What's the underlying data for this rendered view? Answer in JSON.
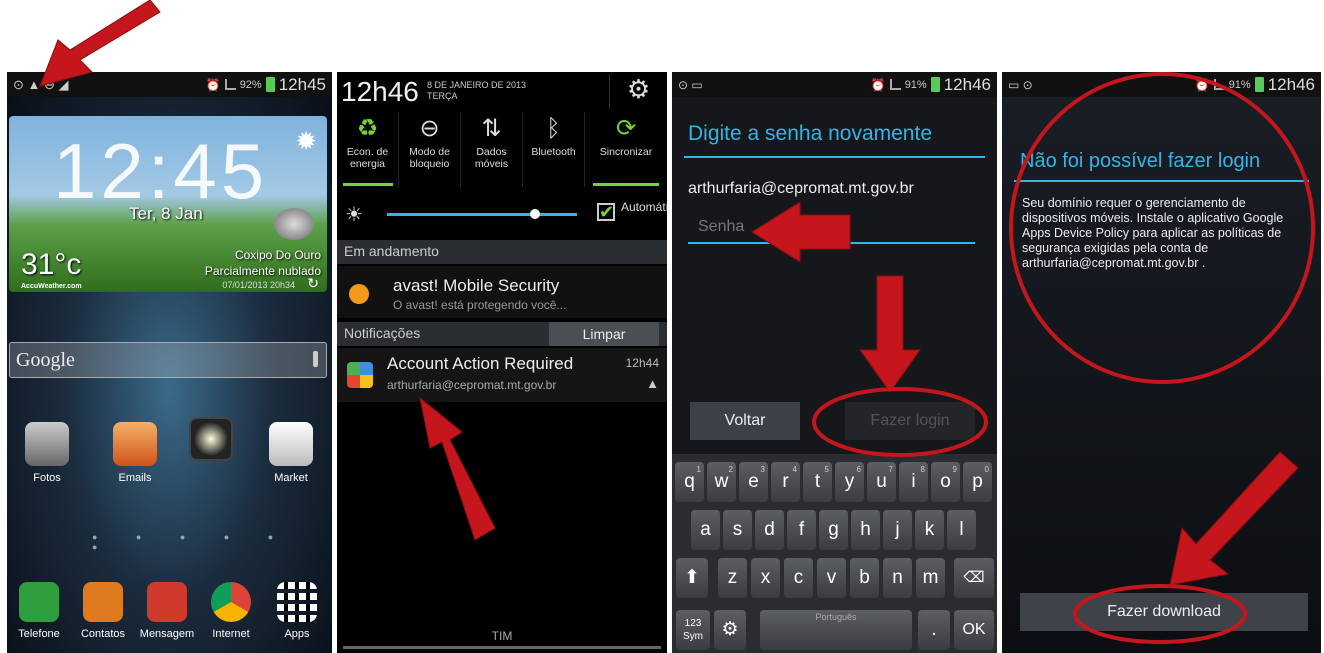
{
  "panel1": {
    "status_time": "12h45",
    "battery": "92%",
    "clock": "12:45",
    "date": "Ter, 8 Jan",
    "temp": "31°c",
    "location": "Coxipo Do Ouro",
    "weather": "Parcialmente nublado",
    "updated": "07/01/2013 20h34",
    "accuweather": "AccuWeather.com",
    "search": "Google",
    "row1": [
      "Fotos",
      "Emails",
      "",
      "Market"
    ],
    "dock": [
      "Telefone",
      "Contatos",
      "Mensagem",
      "Internet",
      "Apps"
    ]
  },
  "panel2": {
    "time": "12h46",
    "date": "8 DE JANEIRO DE 2013",
    "weekday": "TERÇA",
    "toggles": [
      "Econ. de energia",
      "Modo de bloqueio",
      "Dados móveis",
      "Bluetooth",
      "Sincronizar"
    ],
    "auto_label": "Automático",
    "ongoing": "Em andamento",
    "avast_title": "avast! Mobile Security",
    "avast_sub": "O avast! está protegendo você...",
    "notifications": "Notificações",
    "clear": "Limpar",
    "account_title": "Account Action Required",
    "account_email": "arthurfaria@cepromat.mt.gov.br",
    "account_time": "12h44",
    "carrier": "TIM"
  },
  "panel3": {
    "status_time": "12h46",
    "battery": "91%",
    "title": "Digite a senha novamente",
    "email": "arthurfaria@cepromat.mt.gov.br",
    "password_placeholder": "Senha",
    "back": "Voltar",
    "login": "Fazer login",
    "row1": [
      "q",
      "w",
      "e",
      "r",
      "t",
      "y",
      "u",
      "i",
      "o",
      "p"
    ],
    "row1_nums": [
      "1",
      "2",
      "3",
      "4",
      "5",
      "6",
      "7",
      "8",
      "9",
      "0"
    ],
    "row2": [
      "a",
      "s",
      "d",
      "f",
      "g",
      "h",
      "j",
      "k",
      "l"
    ],
    "row3": [
      "z",
      "x",
      "c",
      "v",
      "b",
      "n",
      "m"
    ],
    "sym": "123 Sym",
    "lang": "Português",
    "period": ".",
    "ok": "OK"
  },
  "panel4": {
    "status_time": "12h46",
    "battery": "91%",
    "title": "Não foi possível fazer login",
    "message": "Seu domínio requer o gerenciamento de dispositivos móveis. Instale o aplicativo Google Apps Device Policy para aplicar as políticas de segurança exigidas pela conta de  arthurfaria@cepromat.mt.gov.br .",
    "download": "Fazer download"
  },
  "colors": {
    "accent": "#33b5e5",
    "annotation": "#c4161c",
    "sync_green": "#76d23a"
  }
}
